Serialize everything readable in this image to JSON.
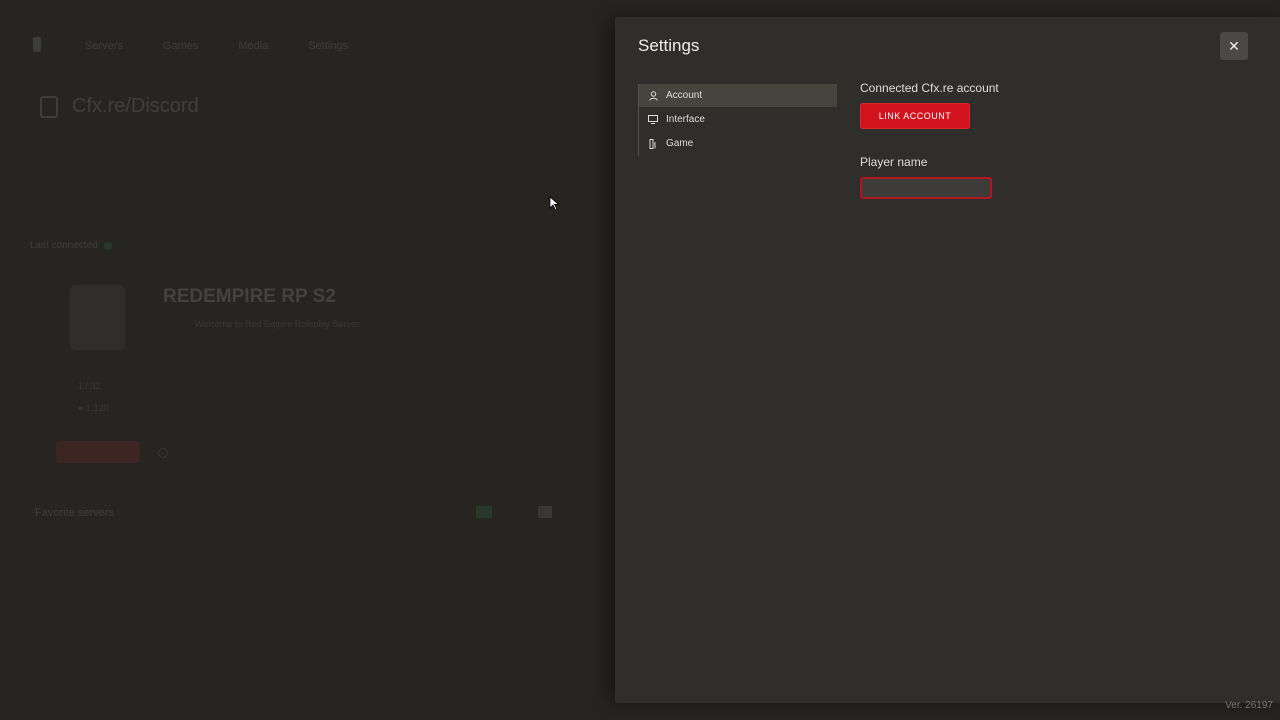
{
  "background": {
    "nav": [
      "Servers",
      "Games",
      "Media",
      "Settings"
    ],
    "hero_title": "Cfx.re/Discord",
    "section_label": "Last connected",
    "server_name": "REDEMPIRE RP S2",
    "server_desc": "Welcome to Red Empire Roleplay Server",
    "stats": [
      "1 / 32",
      "● 1,120"
    ],
    "list_header": "Favorite servers"
  },
  "settings": {
    "title": "Settings",
    "close_icon": "close-icon",
    "menu": [
      {
        "label": "Account",
        "icon": "user-icon",
        "active": true
      },
      {
        "label": "Interface",
        "icon": "monitor-icon",
        "active": false
      },
      {
        "label": "Game",
        "icon": "game-icon",
        "active": false
      }
    ],
    "account": {
      "linked_label": "Connected Cfx.re account",
      "link_button": "LINK ACCOUNT",
      "player_name_label": "Player name",
      "player_name_value": "",
      "player_name_placeholder": ""
    }
  },
  "version": "Ver. 26197",
  "colors": {
    "accent": "#d2121d",
    "panel": "#2f2e2b",
    "background": "#262522"
  }
}
